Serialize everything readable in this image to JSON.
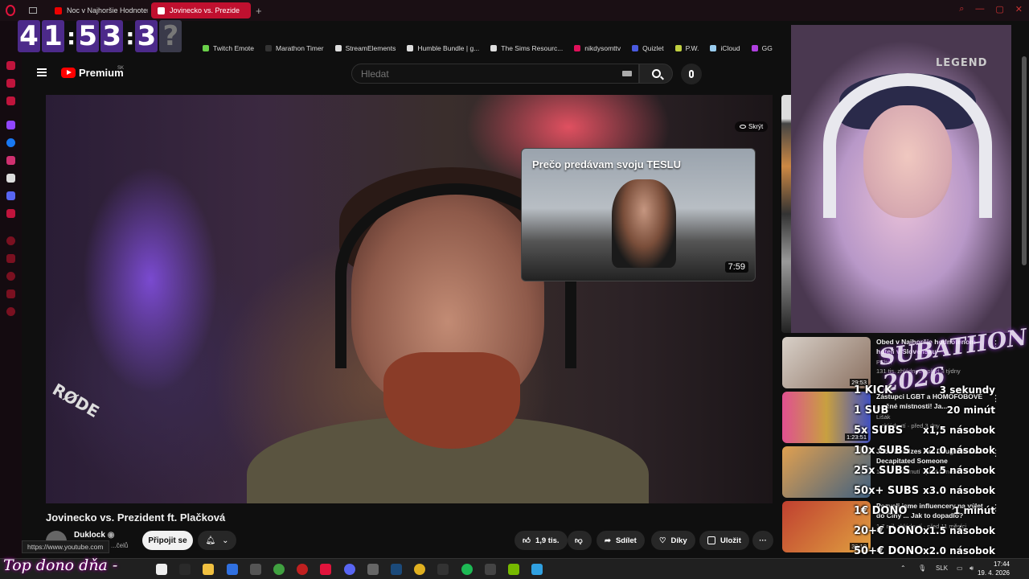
{
  "browser": {
    "tabs": [
      {
        "label": "Noc v Najhoršie Hodnoten",
        "active": false
      },
      {
        "label": "Jovinecko vs. Prezide",
        "active": true
      }
    ],
    "new_tab": "+",
    "bookmarks": [
      {
        "label": "Twitch Emote",
        "color": "#6ad04a"
      },
      {
        "label": "Marathon Timer",
        "color": "#333333"
      },
      {
        "label": "StreamElements",
        "color": "#dddddd"
      },
      {
        "label": "Humble Bundle | g...",
        "color": "#dddddd"
      },
      {
        "label": "The Sims Resourc...",
        "color": "#dddddd"
      },
      {
        "label": "nikdysomttv",
        "color": "#e0105a"
      },
      {
        "label": "Quizlet",
        "color": "#4a5ae0"
      },
      {
        "label": "P.W.",
        "color": "#c0d040"
      },
      {
        "label": "iCloud",
        "color": "#99ccee"
      },
      {
        "label": "GG",
        "color": "#b040e0"
      }
    ],
    "bookmarks_more": "›"
  },
  "timer": {
    "digits": [
      "4",
      "1",
      "5",
      "3",
      "3"
    ],
    "trailing": "?"
  },
  "youtube": {
    "brand": "Premium",
    "country": "SK",
    "search_placeholder": "Hledat",
    "player": {
      "hide_label": "Skrýt",
      "watermark": "RØDE",
      "card_title": "Prečo predávam svoju TESLU",
      "card_duration": "7:59"
    },
    "video_title": "Jovinecko vs. Prezident ft. Plačková",
    "channel": "Duklock",
    "subscribers": "...čelů",
    "join_label": "Připojit se",
    "likes": "1,9 tis.",
    "share_label": "Sdílet",
    "thanks_label": "Díky",
    "save_label": "Uložit",
    "more_label": "···",
    "url_tooltip": "https://www.youtube.com"
  },
  "recommendations": [
    {
      "title": "Obed v Najhoršie hodnotenom hoteli v Slovensku",
      "channel": "PFlter",
      "meta": "131 tis. zhlédnutí · před 3 týdny",
      "duration": "29:53",
      "thumb_colors": [
        "#d8d0c8",
        "#8a7060"
      ]
    },
    {
      "title": "Zástupci LGBT a HOMOFOBOVÉ ...ečné místnosti! Ja...",
      "channel": "Lišák",
      "meta": "...zhlédnutí · před 3 dny",
      "duration": "1:23:51",
      "thumb_colors": [
        "#e05090",
        "#4050c0"
      ]
    },
    {
      "title": "Jobs Realizes Her Daughter Just Decapitated Someone",
      "channel": "",
      "meta": "12 mil. zhlédnutí · před 5 měsíci",
      "duration": "",
      "thumb_colors": [
        "#e0a050",
        "#406080"
      ]
    },
    {
      "title": "Pozvali jsme influencery na výlet do Číny ... Jak to dopadlo?",
      "channel": "",
      "meta": "1,7 mil. zhlédnutí · před 11 měsíci",
      "duration": "39:10",
      "thumb_colors": [
        "#c04030",
        "#e0a040"
      ]
    }
  ],
  "overlay": {
    "subathon_text": "SUBATHON 2026",
    "rows": [
      {
        "left": "1 KICK",
        "right": "3 sekundy"
      },
      {
        "left": "1 SUB",
        "right": "20 minút"
      },
      {
        "left": "5x SUBS",
        "right": "x1,5 násobok"
      },
      {
        "left": "10x SUBS",
        "right": "x2.0 násobok"
      },
      {
        "left": "25x SUBS",
        "right": "x2.5 násobok"
      },
      {
        "left": "50x+ SUBS",
        "right": "x3.0 násobok"
      },
      {
        "left": "1€ DONO",
        "right": "1 minút"
      },
      {
        "left": "20+€ DONO",
        "right": "x1.5 násobok"
      },
      {
        "left": "50+€ DONO",
        "right": "x2.0 násobok"
      }
    ],
    "bottom_text": "Top dono dňa -"
  },
  "taskbar": {
    "language": "SLK",
    "time": "17:44",
    "date": "19. 4. 2026",
    "icons": [
      {
        "name": "file-icon",
        "color": "#eeeeee"
      },
      {
        "name": "terminal-icon",
        "color": "#2a2a2a"
      },
      {
        "name": "folder-icon",
        "color": "#f0c040"
      },
      {
        "name": "store-icon",
        "color": "#3070e0"
      },
      {
        "name": "app-icon",
        "color": "#555555"
      },
      {
        "name": "xbox-icon",
        "color": "#40a040"
      },
      {
        "name": "record-icon",
        "color": "#c02020"
      },
      {
        "name": "opera-icon",
        "color": "#e0143c"
      },
      {
        "name": "discord-icon",
        "color": "#5865f2"
      },
      {
        "name": "steam-gear-icon",
        "color": "#666666"
      },
      {
        "name": "steam-icon",
        "color": "#1b4a7a"
      },
      {
        "name": "chrome-icon",
        "color": "#e0b020"
      },
      {
        "name": "obs-icon",
        "color": "#333333"
      },
      {
        "name": "spotify-icon",
        "color": "#1db954"
      },
      {
        "name": "monitor-icon",
        "color": "#444444"
      },
      {
        "name": "nvidia-icon",
        "color": "#76b900"
      },
      {
        "name": "stack-icon",
        "color": "#30a0e0"
      }
    ]
  }
}
